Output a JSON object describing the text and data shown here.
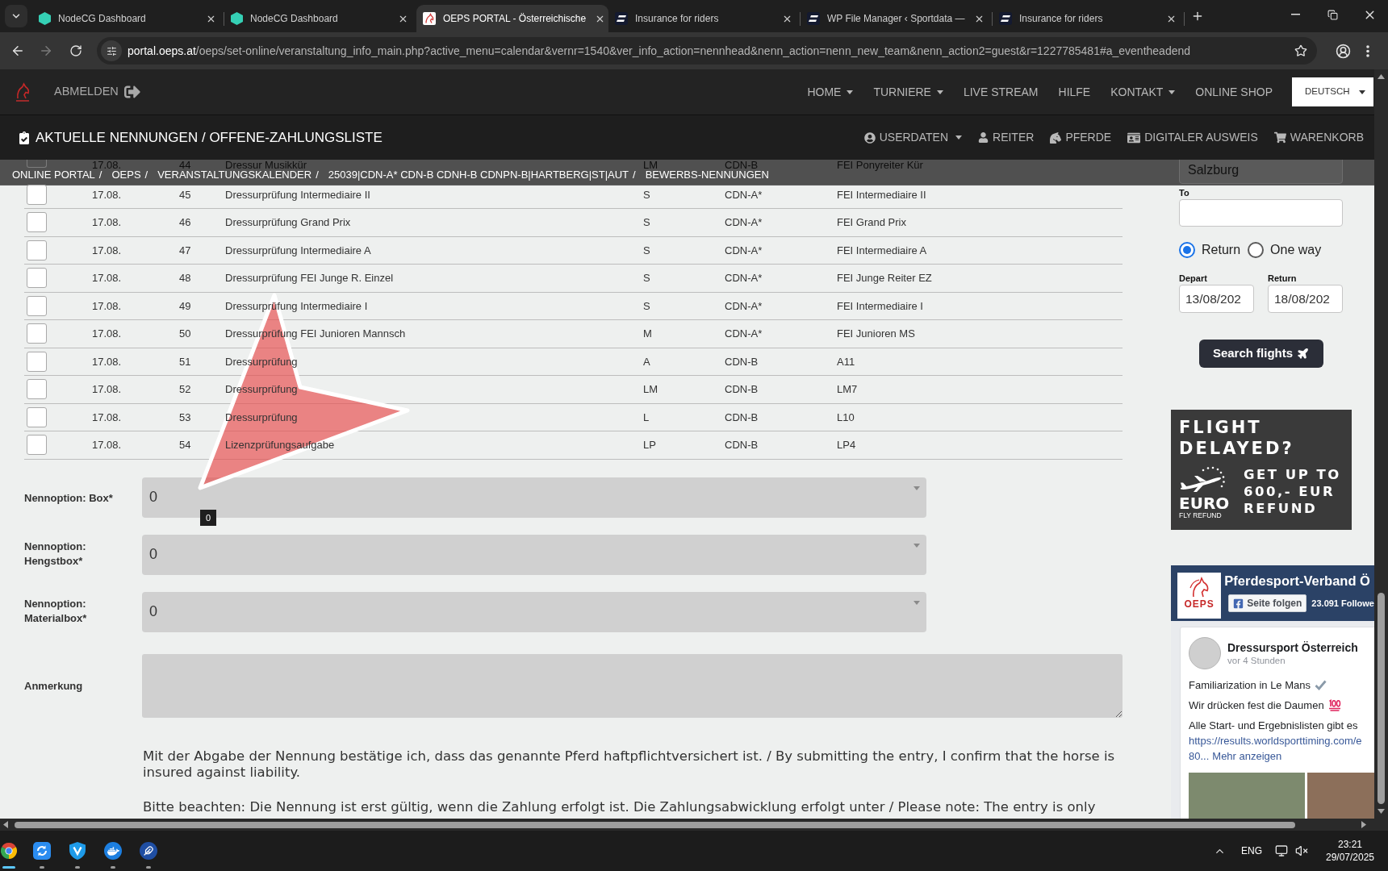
{
  "browser": {
    "tabs": [
      {
        "kind": "hexagon",
        "title": "NodeCG Dashboard",
        "selected": false
      },
      {
        "kind": "hexagon",
        "title": "NodeCG Dashboard",
        "selected": false
      },
      {
        "kind": "horse",
        "title": "OEPS PORTAL - Österreichische",
        "selected": true
      },
      {
        "kind": "s-logo",
        "title": "Insurance for riders",
        "selected": false
      },
      {
        "kind": "s-logo",
        "title": "WP File Manager ‹ Sportdata —",
        "selected": false
      },
      {
        "kind": "s-logo",
        "title": "Insurance for riders",
        "selected": false
      }
    ],
    "address_bar": {
      "domain": "portal.oeps.at",
      "path": "/oeps/set-online/veranstaltung_info_main.php?active_menu=calendar&vernr=1540&ver_info_action=nennhead&nenn_action=nenn_new_team&nenn_action2=guest&r=1227785481#a_eventheadend",
      "forward_disabled": true
    }
  },
  "navbar": {
    "logout": "ABMELDEN",
    "items": [
      {
        "label": "HOME",
        "dropdown": true
      },
      {
        "label": "TURNIERE",
        "dropdown": true
      },
      {
        "label": "LIVE STREAM",
        "dropdown": false
      },
      {
        "label": "HILFE",
        "dropdown": false
      },
      {
        "label": "KONTAKT",
        "dropdown": true
      },
      {
        "label": "ONLINE SHOP",
        "dropdown": false
      }
    ],
    "language": "DEUTSCH"
  },
  "subnav": {
    "title": "AKTUELLE NENNUNGEN / OFFENE-ZAHLUNGSLISTE",
    "items": [
      {
        "kind": "user-circle",
        "label": "USERDATEN",
        "dropdown": true
      },
      {
        "kind": "user",
        "label": "REITER",
        "dropdown": false
      },
      {
        "kind": "horse",
        "label": "PFERDE",
        "dropdown": false
      },
      {
        "kind": "id-card",
        "label": "DIGITALER AUSWEIS",
        "dropdown": false
      },
      {
        "kind": "cart",
        "label": "WARENKORB",
        "dropdown": false
      }
    ]
  },
  "breadcrumb": [
    {
      "label": "ONLINE PORTAL",
      "separator": "/"
    },
    {
      "label": "OEPS",
      "separator": "/"
    },
    {
      "label": "VERANSTALTUNGSKALENDER",
      "separator": "/"
    },
    {
      "label": "25039|CDN-A* CDN-B CDNH-B CDNPN-B|HARTBERG|ST|AUT",
      "separator": "/"
    },
    {
      "label": "BEWERBS-NENNUNGEN"
    }
  ],
  "table": {
    "rows": [
      {
        "checked": false,
        "cells": [
          "17.08.",
          "44",
          "Dressur Musikkür",
          "LM",
          "CDN-B",
          "FEI Ponyreiter Kür"
        ]
      },
      {
        "checked": false,
        "cells": [
          "17.08.",
          "45",
          "Dressurprüfung Intermediaire II",
          "S",
          "CDN-A*",
          "FEI Intermediaire II"
        ]
      },
      {
        "checked": false,
        "cells": [
          "17.08.",
          "46",
          "Dressurprüfung Grand Prix",
          "S",
          "CDN-A*",
          "FEI Grand Prix"
        ]
      },
      {
        "checked": false,
        "cells": [
          "17.08.",
          "47",
          "Dressurprüfung Intermediaire A",
          "S",
          "CDN-A*",
          "FEI Intermediaire A"
        ]
      },
      {
        "checked": false,
        "cells": [
          "17.08.",
          "48",
          "Dressurprüfung FEI Junge R. Einzel",
          "S",
          "CDN-A*",
          "FEI Junge Reiter EZ"
        ]
      },
      {
        "checked": false,
        "cells": [
          "17.08.",
          "49",
          "Dressurprüfung Intermediaire I",
          "S",
          "CDN-A*",
          "FEI Intermediaire I"
        ]
      },
      {
        "checked": false,
        "cells": [
          "17.08.",
          "50",
          "Dressurprüfung FEI Junioren Mannsch",
          "M",
          "CDN-A*",
          "FEI Junioren MS"
        ]
      },
      {
        "checked": false,
        "cells": [
          "17.08.",
          "51",
          "Dressurprüfung",
          "A",
          "CDN-B",
          "A11"
        ]
      },
      {
        "checked": false,
        "cells": [
          "17.08.",
          "52",
          "Dressurprüfung",
          "LM",
          "CDN-B",
          "LM7"
        ]
      },
      {
        "checked": false,
        "cells": [
          "17.08.",
          "53",
          "Dressurprüfung",
          "L",
          "CDN-B",
          "L10"
        ]
      },
      {
        "checked": false,
        "cells": [
          "17.08.",
          "54",
          "Lizenzprüfungsaufgabe",
          "LP",
          "CDN-B",
          "LP4"
        ]
      }
    ]
  },
  "form": {
    "options": [
      {
        "label": "Nennoption: Box*",
        "value": "0"
      },
      {
        "label": "Nennoption: Hengstbox*",
        "value": "0"
      },
      {
        "label": "Nennoption: Materialbox*",
        "value": "0"
      }
    ],
    "tooltip": "0",
    "remark_label": "Anmerkung",
    "notes": [
      "Mit der Abgabe der Nennung bestätige ich, dass das genannte Pferd haftpflichtversichert ist. / By submitting the entry, I confirm that the horse is insured against liability.",
      "Bitte beachten: Die Nennung ist erst gültig, wenn die Zahlung erfolgt ist. Die Zahlungsabwicklung erfolgt unter / Please note: The entry is only"
    ]
  },
  "flight_search": {
    "origin_value": "Salzburg",
    "to_label": "To",
    "trip_types": [
      {
        "label": "Return",
        "selected": true
      },
      {
        "label": "One way",
        "selected": false
      }
    ],
    "depart_label": "Depart",
    "depart_value": "13/08/202",
    "return_label": "Return",
    "return_value": "18/08/202",
    "button": "Search flights"
  },
  "ad": {
    "headline": [
      "FLIGHT",
      "DELAYED?"
    ],
    "brand": "EURO",
    "brand_tagline": "FLY REFUND",
    "offer": [
      "GET UP TO",
      "600,- EUR",
      "REFUND"
    ]
  },
  "social_widget": {
    "logo_text": "OEPS",
    "page_name": "Pferdesport-Verband Ö",
    "follow_button": "Seite folgen",
    "followers": "23.091 Followe",
    "post": {
      "author": "Dressursport Österreich",
      "time": "vor 4 Stunden",
      "lines": [
        {
          "text": "Familiarization in Le Mans",
          "kind": "check"
        },
        {
          "text": "Wir drücken fest die Daumen",
          "kind": "hundred"
        },
        {
          "text": "Alle Start- und Ergebnislisten gibt es",
          "kind": "plain"
        }
      ],
      "link": "https://results.worldsporttiming.com/e",
      "link_tail": "80...",
      "more": "Mehr anzeigen"
    }
  },
  "taskbar": {
    "apps": [
      {
        "kind": "browser",
        "selected": true
      },
      {
        "kind": "sync",
        "selected": false
      },
      {
        "kind": "shield",
        "selected": false
      },
      {
        "kind": "whale",
        "selected": false
      },
      {
        "kind": "feather",
        "selected": false
      }
    ],
    "language": "ENG",
    "time": "23:21",
    "date": "29/07/2025"
  }
}
